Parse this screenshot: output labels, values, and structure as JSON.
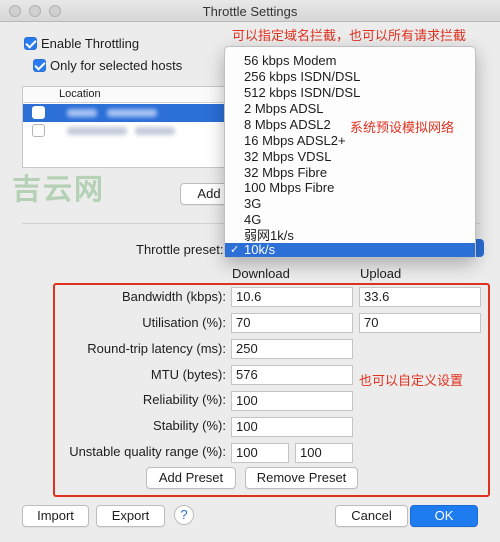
{
  "window": {
    "title": "Throttle Settings"
  },
  "options": {
    "enable_throttling": "Enable Throttling",
    "only_selected_hosts": "Only for selected hosts"
  },
  "annotations": {
    "domain_note": "可以指定域名拦截，也可以所有请求拦截",
    "preset_note": "系统预设模拟网络",
    "custom_note": "也可以自定义设置"
  },
  "hosts": {
    "column_location": "Location",
    "add_button": "Add"
  },
  "watermark": "吉云网",
  "preset": {
    "label": "Throttle preset:",
    "selected": "10k/s",
    "options": [
      "56 kbps Modem",
      "256 kbps ISDN/DSL",
      "512 kbps ISDN/DSL",
      "2 Mbps ADSL",
      "8 Mbps ADSL2",
      "16 Mbps ADSL2+",
      "32 Mbps VDSL",
      "32 Mbps Fibre",
      "100 Mbps Fibre",
      "3G",
      "4G",
      "弱网1k/s",
      "10k/s"
    ]
  },
  "settings": {
    "col_download": "Download",
    "col_upload": "Upload",
    "bandwidth_label": "Bandwidth (kbps):",
    "bandwidth_down": "10.6",
    "bandwidth_up": "33.6",
    "utilisation_label": "Utilisation (%):",
    "utilisation_down": "70",
    "utilisation_up": "70",
    "latency_label": "Round-trip latency (ms):",
    "latency": "250",
    "mtu_label": "MTU (bytes):",
    "mtu": "576",
    "reliability_label": "Reliability (%):",
    "reliability": "100",
    "stability_label": "Stability (%):",
    "stability": "100",
    "unstable_label": "Unstable quality range (%):",
    "unstable_min": "100",
    "unstable_max": "100",
    "add_preset": "Add Preset",
    "remove_preset": "Remove Preset"
  },
  "footer": {
    "import": "Import",
    "export": "Export",
    "help": "?",
    "cancel": "Cancel",
    "ok": "OK"
  },
  "colors": {
    "accent": "#2b6fd7",
    "annotation": "#e0301e"
  }
}
